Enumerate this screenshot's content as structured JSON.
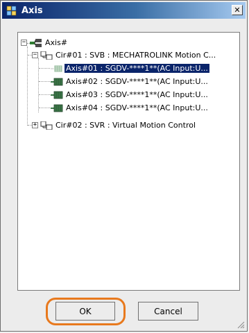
{
  "window": {
    "title": "Axis"
  },
  "tree": {
    "root": {
      "label": "Axis#"
    },
    "nodes": [
      {
        "label": "Cir#01 : SVB : MECHATROLINK Motion C..."
      },
      {
        "label": "Axis#01 : SGDV-****1**(AC Input:U..."
      },
      {
        "label": "Axis#02 : SGDV-****1**(AC Input:U..."
      },
      {
        "label": "Axis#03 : SGDV-****1**(AC Input:U..."
      },
      {
        "label": "Axis#04 : SGDV-****1**(AC Input:U..."
      },
      {
        "label": "Cir#02 : SVR : Virtual Motion Control"
      }
    ]
  },
  "buttons": {
    "ok": "OK",
    "cancel": "Cancel"
  },
  "colors": {
    "highlight_ring": "#e8791d",
    "selection": "#0a246a",
    "titlebar": "#0a246a"
  }
}
